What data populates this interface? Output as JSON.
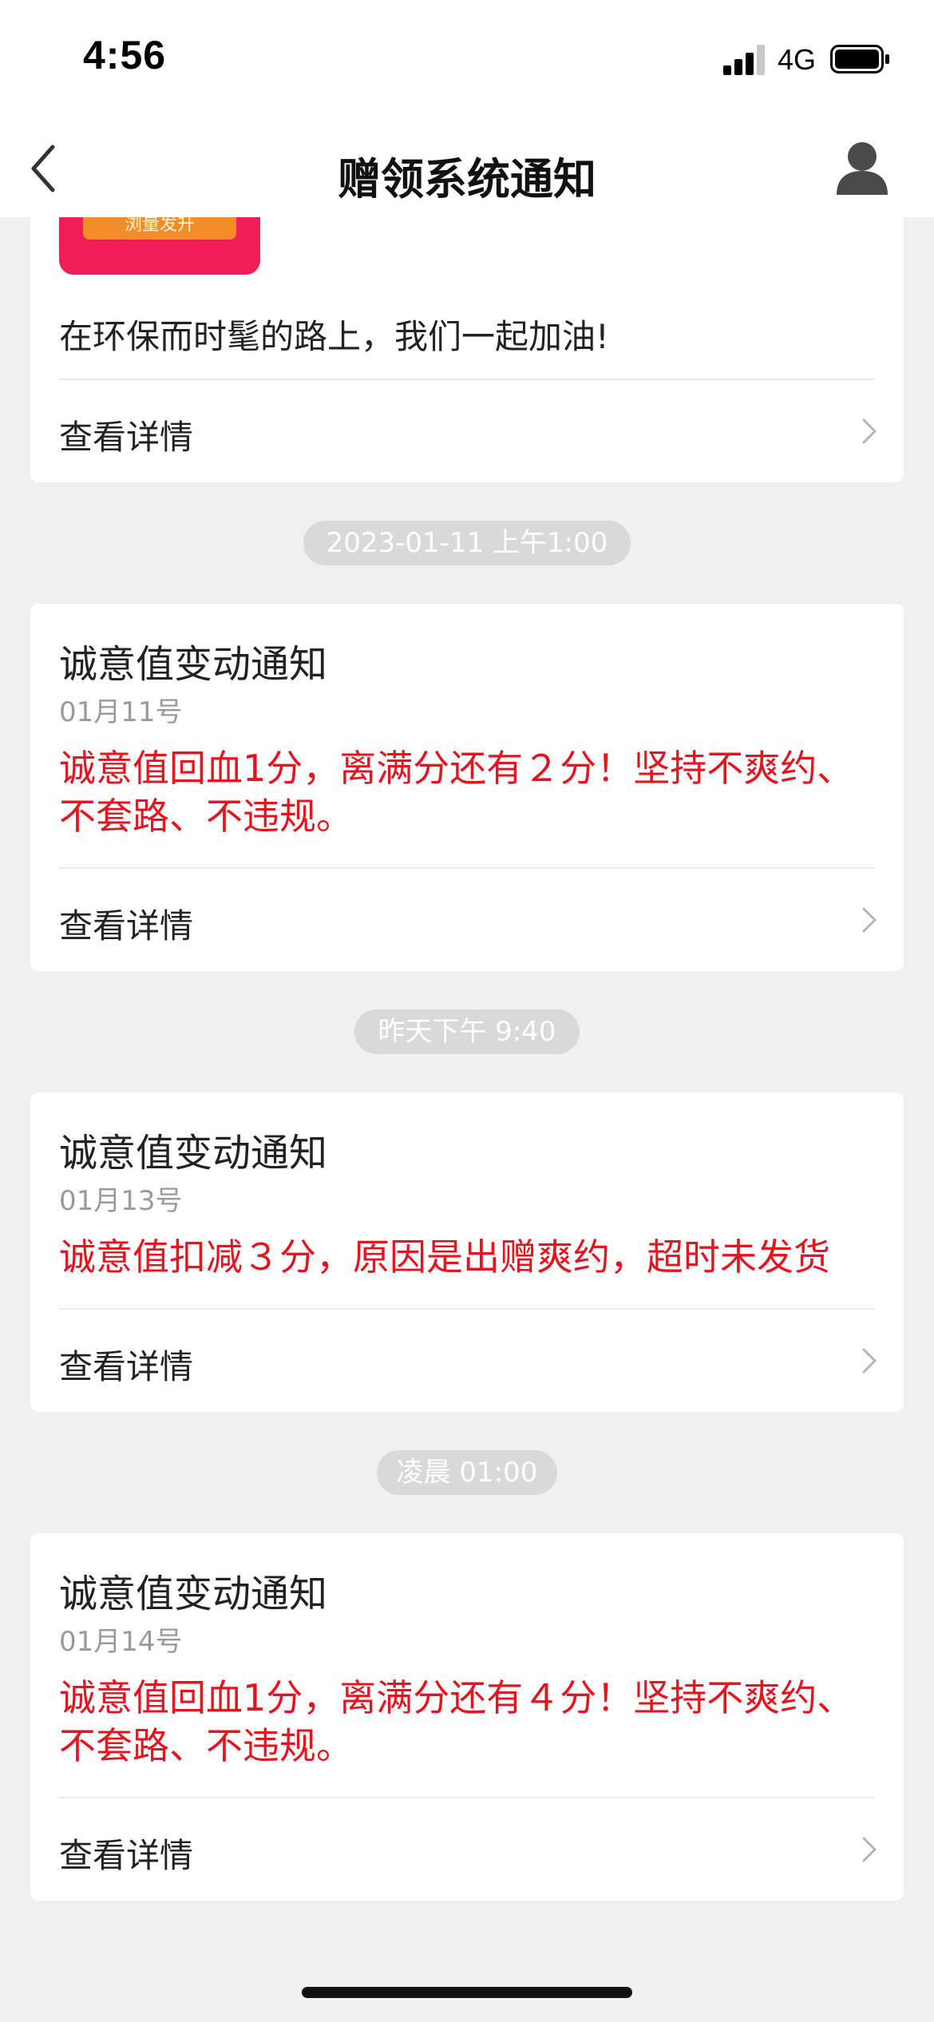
{
  "status_bar": {
    "time": "4:56",
    "network": "4G",
    "signal_icon": "signal-bars-icon",
    "battery_icon": "battery-icon"
  },
  "nav": {
    "title": "赠领系统通知",
    "back_icon": "chevron-left-icon",
    "profile_icon": "person-icon"
  },
  "colors": {
    "accent_red": "#e5141e",
    "promo_pink": "#ef1e57",
    "promo_orange": "#f28d2a",
    "pill_gray": "#d9d9d9",
    "background": "#f0f0f0"
  },
  "messages": [
    {
      "promo_banner_text": "浏量发升",
      "body": "在环保而时髦的路上，我们一起加油!",
      "detail_label": "查看详情"
    },
    {
      "timestamp": "2023-01-11 上午1:00",
      "title": "诚意值变动通知",
      "date": "01月11号",
      "body": "诚意值回血1分，离满分还有２分！坚持不爽约、不套路、不违规。",
      "detail_label": "查看详情"
    },
    {
      "timestamp": "昨天下午 9:40",
      "title": "诚意值变动通知",
      "date": "01月13号",
      "body": "诚意值扣减３分，原因是出赠爽约，超时未发货",
      "detail_label": "查看详情"
    },
    {
      "timestamp": "凌晨 01:00",
      "title": "诚意值变动通知",
      "date": "01月14号",
      "body": "诚意值回血1分，离满分还有４分！坚持不爽约、不套路、不违规。",
      "detail_label": "查看详情"
    }
  ]
}
